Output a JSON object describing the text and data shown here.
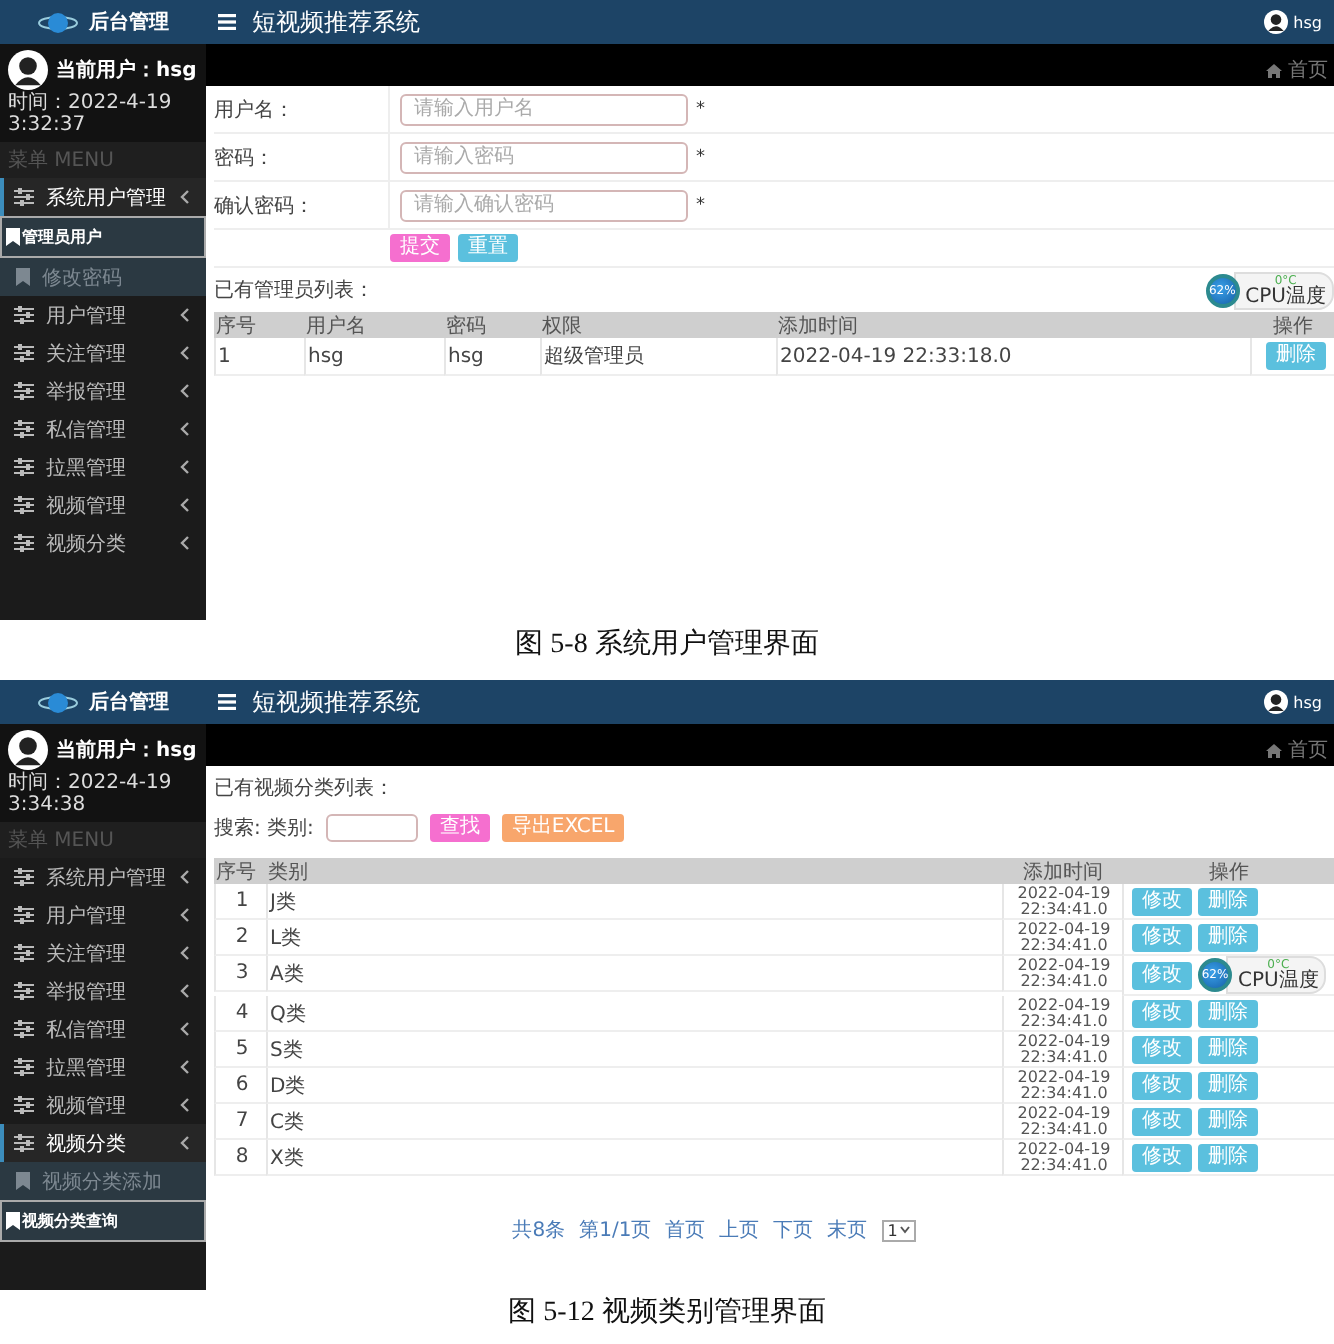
{
  "figures": [
    {
      "kind": "user_admin",
      "caption": "图 5-8 系统用户管理界面",
      "screen": {
        "logo_title": "后台管理",
        "app_title": "短视频推荐系统",
        "header_user": "hsg",
        "current_user": "当前用户：hsg",
        "time": "时间：2022-4-19 3:32:37",
        "menu_heading": "菜单 MENU",
        "breadcrumb": "首页",
        "sidebar": [
          {
            "label": "系统用户管理",
            "expanded": true,
            "children": [
              {
                "label": "管理员用户",
                "selected": true
              },
              {
                "label": "修改密码",
                "selected": false
              }
            ]
          },
          {
            "label": "用户管理",
            "expanded": false
          },
          {
            "label": "关注管理",
            "expanded": false
          },
          {
            "label": "举报管理",
            "expanded": false
          },
          {
            "label": "私信管理",
            "expanded": false
          },
          {
            "label": "拉黑管理",
            "expanded": false
          },
          {
            "label": "视频管理",
            "expanded": false
          },
          {
            "label": "视频分类",
            "expanded": false
          }
        ],
        "form": [
          {
            "label": "用户名：",
            "placeholder": "请输入用户名",
            "required_mark": "*"
          },
          {
            "label": "密码：",
            "placeholder": "请输入密码",
            "required_mark": "*"
          },
          {
            "label": "确认密码：",
            "placeholder": "请输入确认密码",
            "required_mark": "*"
          }
        ],
        "buttons": [
          {
            "label": "提交",
            "kind": "submit"
          },
          {
            "label": "重置",
            "kind": "reset"
          }
        ],
        "list_title": "已有管理员列表：",
        "cpu_widget": {
          "percent": "62%",
          "temperature": "0°C",
          "label": "CPU温度"
        },
        "table": {
          "columns": [
            "序号",
            "用户名",
            "密码",
            "权限",
            "添加时间",
            "操作"
          ],
          "rows": [
            {
              "cells": [
                "1",
                "hsg",
                "hsg",
                "超级管理员",
                "2022-04-19 22:33:18.0"
              ],
              "actions": [
                "删除"
              ]
            }
          ]
        }
      }
    },
    {
      "kind": "category_list",
      "caption": "图 5-12 视频类别管理界面",
      "screen": {
        "logo_title": "后台管理",
        "app_title": "短视频推荐系统",
        "header_user": "hsg",
        "current_user": "当前用户：hsg",
        "time": "时间：2022-4-19 3:34:38",
        "menu_heading": "菜单 MENU",
        "breadcrumb": "首页",
        "sidebar": [
          {
            "label": "系统用户管理",
            "expanded": false
          },
          {
            "label": "用户管理",
            "expanded": false
          },
          {
            "label": "关注管理",
            "expanded": false
          },
          {
            "label": "举报管理",
            "expanded": false
          },
          {
            "label": "私信管理",
            "expanded": false
          },
          {
            "label": "拉黑管理",
            "expanded": false
          },
          {
            "label": "视频管理",
            "expanded": false
          },
          {
            "label": "视频分类",
            "expanded": true,
            "children": [
              {
                "label": "视频分类添加",
                "selected": false
              },
              {
                "label": "视频分类查询",
                "selected": true
              }
            ]
          }
        ],
        "list_title": "已有视频分类列表：",
        "search": {
          "label": "搜索: 类别:",
          "buttons": [
            {
              "label": "查找",
              "kind": "search"
            },
            {
              "label": "导出EXCEL",
              "kind": "export"
            }
          ]
        },
        "cpu_widget": {
          "percent": "62%",
          "temperature": "0°C",
          "label": "CPU温度"
        },
        "table": {
          "columns": [
            "序号",
            "类别",
            "添加时间",
            "操作"
          ],
          "rows": [
            {
              "cells": [
                "1",
                "J类",
                "2022-04-19 22:34:41.0"
              ],
              "actions": [
                "修改",
                "删除"
              ]
            },
            {
              "cells": [
                "2",
                "L类",
                "2022-04-19 22:34:41.0"
              ],
              "actions": [
                "修改",
                "删除"
              ]
            },
            {
              "cells": [
                "3",
                "A类",
                "2022-04-19 22:34:41.0"
              ],
              "actions": [
                "修改"
              ]
            },
            {
              "cells": [
                "4",
                "Q类",
                "2022-04-19 22:34:41.0"
              ],
              "actions": [
                "修改",
                "删除"
              ]
            },
            {
              "cells": [
                "5",
                "S类",
                "2022-04-19 22:34:41.0"
              ],
              "actions": [
                "修改",
                "删除"
              ]
            },
            {
              "cells": [
                "6",
                "D类",
                "2022-04-19 22:34:41.0"
              ],
              "actions": [
                "修改",
                "删除"
              ]
            },
            {
              "cells": [
                "7",
                "C类",
                "2022-04-19 22:34:41.0"
              ],
              "actions": [
                "修改",
                "删除"
              ]
            },
            {
              "cells": [
                "8",
                "X类",
                "2022-04-19 22:34:41.0"
              ],
              "actions": [
                "修改",
                "删除"
              ]
            }
          ]
        },
        "pagination": {
          "total": "共8条",
          "page": "第1/1页",
          "links": [
            "首页",
            "上页",
            "下页",
            "末页"
          ],
          "page_select": "1"
        }
      }
    }
  ]
}
